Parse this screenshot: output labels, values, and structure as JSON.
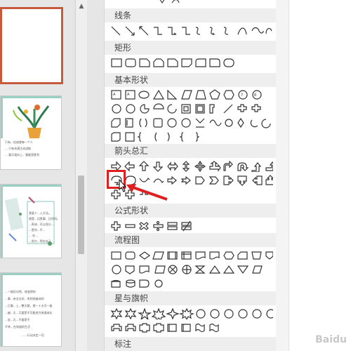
{
  "app": {
    "accent": "#c55a3c",
    "annotation_color": "#e02020"
  },
  "slides": [
    {
      "lines": []
    },
    {
      "lines": [
        "只有...也成就每一个人",
        "... 只有充满主动进取",
        "... 要乐观向上，要能获胜利"
      ]
    },
    {
      "lines": [
        "我爱人...入方法。",
        "就是...比胜事、比时间。",
        "...养成...可以找分...",
        "...胜利...平...",
        "... 在...",
        "...努力...明白自己"
      ]
    },
    {
      "lines": [
        "...一般好对然，效变得的",
        "...事...亲业太好，所则领者成的",
        "...已事...上...整天都，就一十五可一般",
        "...越...天...又要是不可能进力快速成长",
        "...坐...天...不要是不",
        "不幸，在知道的生活",
        "......行动决定一切"
      ]
    }
  ],
  "gallery": {
    "categories": [
      {
        "label": "线条"
      },
      {
        "label": "矩形"
      },
      {
        "label": "基本形状"
      },
      {
        "label": "箭头总汇"
      },
      {
        "label": "公式形状"
      },
      {
        "label": "流程图"
      },
      {
        "label": "星与旗帜"
      },
      {
        "label": "标注"
      }
    ]
  },
  "watermark": "Baidu"
}
